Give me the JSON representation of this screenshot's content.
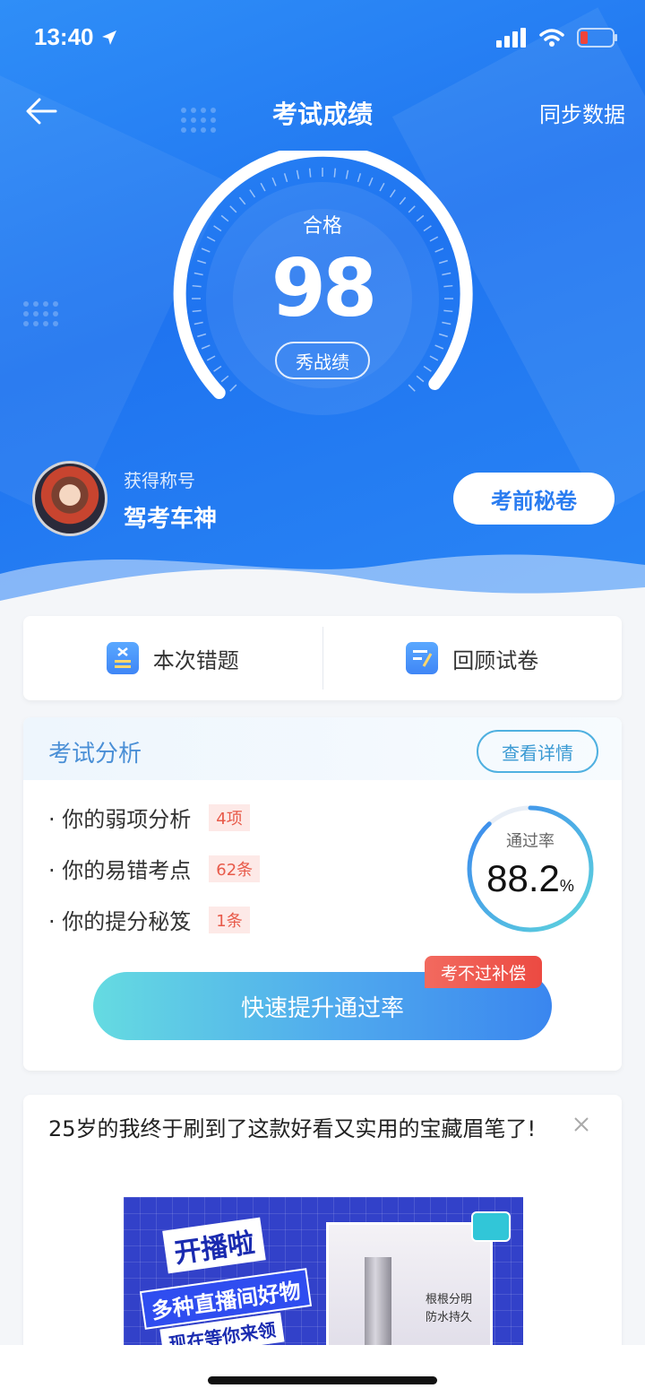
{
  "status_bar": {
    "time": "13:40"
  },
  "nav": {
    "title": "考试成绩",
    "sync_label": "同步数据"
  },
  "score": {
    "result_label": "合格",
    "value": "98",
    "show_button": "秀战绩"
  },
  "profile": {
    "title_caption": "获得称号",
    "title_name": "驾考车神",
    "secret_button": "考前秘卷"
  },
  "actions": {
    "wrong_questions": "本次错题",
    "review_paper": "回顾试卷"
  },
  "analysis": {
    "title": "考试分析",
    "detail_button": "查看详情",
    "items": [
      {
        "label": "· 你的弱项分析",
        "badge": "4项"
      },
      {
        "label": "· 你的易错考点",
        "badge": "62条"
      },
      {
        "label": "· 你的提分秘笈",
        "badge": "1条"
      }
    ],
    "pass_rate_label": "通过率",
    "pass_rate_value": "88.2",
    "pass_rate_unit": "%",
    "pass_rate_fraction": 0.882,
    "boost_button": "快速提升通过率",
    "compensate_tag": "考不过补偿"
  },
  "ad": {
    "text": "25岁的我终于刷到了这款好看又实用的宝藏眉笔了!",
    "promo_line1": "开播啦",
    "promo_line2": "多种直播间好物",
    "promo_line3": "现在等你来领",
    "panel_text_1": "根根分明",
    "panel_text_2": "防水持久"
  },
  "colors": {
    "primary": "#2a7cf0",
    "accent_red": "#e85a4a",
    "teal": "#4fb0e0"
  }
}
